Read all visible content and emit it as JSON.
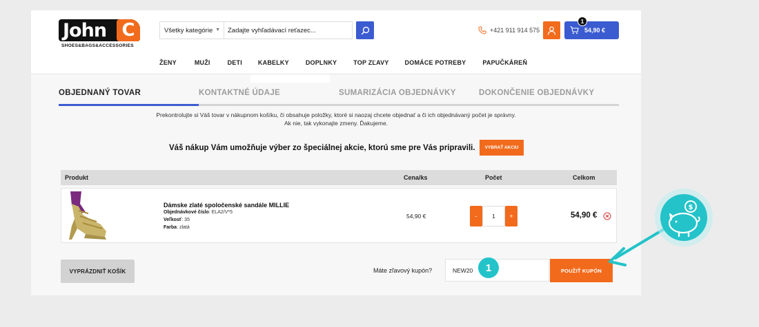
{
  "header": {
    "logo_text": "John",
    "logo_letter": "C",
    "logo_sub": "SHOES&BAGS&ACCESSORIES",
    "category_select": "Všetky kategórie",
    "search_placeholder": "Zadajte vyhľadávací reťazec...",
    "phone": "+421 911 914 575",
    "cart_count": "1",
    "cart_total": "54,90 €"
  },
  "nav": {
    "items": [
      "ŽENY",
      "MUŽI",
      "DETI",
      "KABELKY",
      "DOPLNKY",
      "TOP ZĽAVY",
      "DOMÁCE POTREBY",
      "PAPUČKÁREŇ"
    ]
  },
  "steps": [
    {
      "label": "OBJEDNANÝ TOVAR",
      "active": true
    },
    {
      "label": "KONTAKTNÉ ÚDAJE",
      "active": false
    },
    {
      "label": "SUMARIZÁCIA OBJEDNÁVKY",
      "active": false
    },
    {
      "label": "DOKONČENIE OBJEDNÁVKY",
      "active": false
    }
  ],
  "info": {
    "line1": "Prekontrolujte si Váš tovar v nákupnom košíku, či obsahuje položky, ktoré si naozaj chcete objednať a či ich objednávaný počet je správny.",
    "line2": "Ak nie, tak vykonajte zmeny. Ďakujeme."
  },
  "promo": {
    "text": "Váš nákup Vám umožňuje výber zo špeciálnej akcie, ktorú sme pre Vás pripravili.",
    "button": "VYBRAŤ AKCIU"
  },
  "table": {
    "headers": {
      "product": "Produkt",
      "price": "Cena/ks",
      "qty": "Počet",
      "total": "Celkom"
    },
    "rows": [
      {
        "name": "Dámske zlaté spoločenské sandále MILLIE",
        "order_label": "Objednávkové číslo",
        "order_value": ": ELA2/V*5",
        "size_label": "Veľkosť",
        "size_value": ": 35",
        "color_label": "Farba",
        "color_value": ": zlatá",
        "price": "54,90 €",
        "qty_minus": "-",
        "qty": "1",
        "qty_plus": "+",
        "total": "54,90 €"
      }
    ]
  },
  "footer": {
    "empty_cart": "VYPRÁZDNIŤ KOŠÍK",
    "coupon_label": "Máte zľavový kupón?",
    "coupon_value": "NEW20",
    "coupon_button": "POUŽIŤ KUPÓN"
  },
  "annotation": {
    "step_number": "1"
  },
  "colors": {
    "accent_orange": "#f26b1d",
    "accent_blue": "#3b5bd1",
    "annotation_teal": "#23c3c9"
  }
}
